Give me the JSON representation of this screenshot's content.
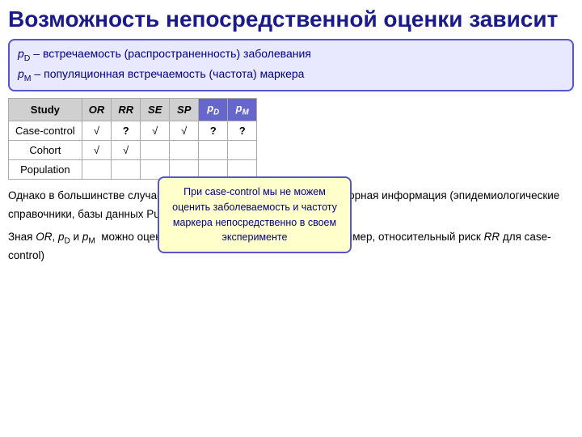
{
  "title": "Возможность непосредственной оценки зависит",
  "info_box": {
    "line1": "pᴅ – встречаемость (распространенность) заболевания",
    "line2": "pᴹ – популяционная встречаемость (частота) маркера"
  },
  "table": {
    "headers": [
      "Study",
      "OR",
      "RR",
      "SE",
      "SP",
      "pD",
      "pM"
    ],
    "rows": [
      [
        "Case-control",
        "√",
        "?",
        "√",
        "√",
        "?",
        "?"
      ],
      [
        "Cohort",
        "√",
        "√",
        "",
        "",
        "",
        ""
      ],
      [
        "Population",
        "",
        "",
        "",
        "",
        "",
        ""
      ]
    ]
  },
  "tooltip": {
    "text": "При case-control мы не можем оценить заболеваемость и частоту маркера непосредственно в своем эксперименте"
  },
  "bottom_paragraphs": {
    "p1": "Однако в большинстве случаев в отношении pD и pM имеется априорная информация (эпидемиологические справочники, базы данных PubMed, HapMap и т.д.)",
    "p2": "Зная OR, pD и pM  можно оценить все остальные показатели (например, относительный риск RR для case-control)"
  }
}
